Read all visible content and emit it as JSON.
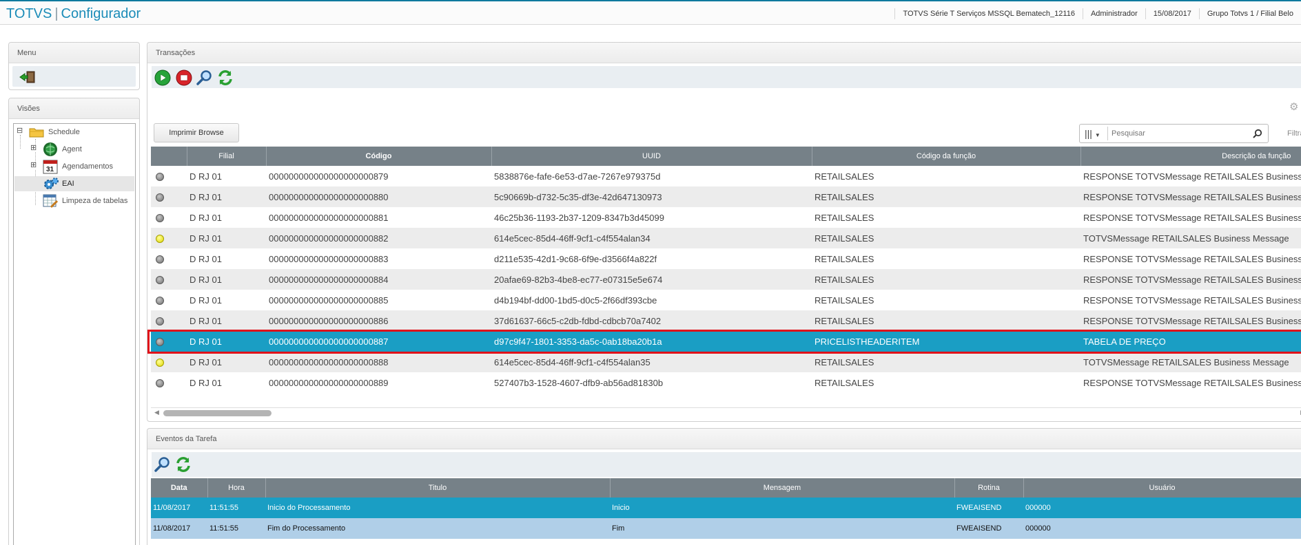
{
  "app": {
    "brand": "TOTVS",
    "separator": "|",
    "module": "Configurador"
  },
  "topinfo": {
    "environment": "TOTVS Série T Serviços MSSQL Bematech_12116",
    "user": "Administrador",
    "date": "15/08/2017",
    "company": "Grupo Totvs 1 / Filial Belo"
  },
  "menu": {
    "title": "Menu"
  },
  "visoes": {
    "title": "Visões",
    "root": {
      "toggle": "⊟",
      "label": "Schedule"
    },
    "items": [
      {
        "toggle": "⊞",
        "label": "Agent"
      },
      {
        "toggle": "⊞",
        "label": "Agendamentos"
      },
      {
        "toggle": "",
        "label": "EAI"
      },
      {
        "toggle": "",
        "label": "Limpeza de tabelas"
      }
    ]
  },
  "transacoes": {
    "title": "Transações",
    "print_button": "Imprimir Browse",
    "search_placeholder": "Pesquisar",
    "columns_icon": "|||",
    "filter_label": "Filtra",
    "columns": [
      "",
      "Filial",
      "Código",
      "UUID",
      "Código da função",
      "Descrição da função"
    ],
    "rows": [
      {
        "status": "gray",
        "filial": "D RJ 01",
        "codigo": "000000000000000000000879",
        "uuid": "5838876e-fafe-6e53-d7ae-7267e979375d",
        "funcao": "RETAILSALES",
        "descricao": "RESPONSE TOTVSMessage RETAILSALES Business"
      },
      {
        "status": "gray",
        "filial": "D RJ 01",
        "codigo": "000000000000000000000880",
        "uuid": "5c90669b-d732-5c35-df3e-42d647130973",
        "funcao": "RETAILSALES",
        "descricao": "RESPONSE TOTVSMessage RETAILSALES Business"
      },
      {
        "status": "gray",
        "filial": "D RJ 01",
        "codigo": "000000000000000000000881",
        "uuid": "46c25b36-1193-2b37-1209-8347b3d45099",
        "funcao": "RETAILSALES",
        "descricao": "RESPONSE TOTVSMessage RETAILSALES Business"
      },
      {
        "status": "yellow",
        "filial": "D RJ 01",
        "codigo": "000000000000000000000882",
        "uuid": "614e5cec-85d4-46ff-9cf1-c4f554alan34",
        "funcao": "RETAILSALES",
        "descricao": "TOTVSMessage RETAILSALES Business Message"
      },
      {
        "status": "gray",
        "filial": "D RJ 01",
        "codigo": "000000000000000000000883",
        "uuid": "d211e535-42d1-9c68-6f9e-d3566f4a822f",
        "funcao": "RETAILSALES",
        "descricao": "RESPONSE TOTVSMessage RETAILSALES Business"
      },
      {
        "status": "gray",
        "filial": "D RJ 01",
        "codigo": "000000000000000000000884",
        "uuid": "20afae69-82b3-4be8-ec77-e07315e5e674",
        "funcao": "RETAILSALES",
        "descricao": "RESPONSE TOTVSMessage RETAILSALES Business"
      },
      {
        "status": "gray",
        "filial": "D RJ 01",
        "codigo": "000000000000000000000885",
        "uuid": "d4b194bf-dd00-1bd5-d0c5-2f66df393cbe",
        "funcao": "RETAILSALES",
        "descricao": "RESPONSE TOTVSMessage RETAILSALES Business"
      },
      {
        "status": "gray",
        "filial": "D RJ 01",
        "codigo": "000000000000000000000886",
        "uuid": "37d61637-66c5-c2db-fdbd-cdbcb70a7402",
        "funcao": "RETAILSALES",
        "descricao": "RESPONSE TOTVSMessage RETAILSALES Business"
      },
      {
        "status": "gray",
        "filial": "D RJ 01",
        "codigo": "000000000000000000000887",
        "uuid": "d97c9f47-1801-3353-da5c-0ab18ba20b1a",
        "funcao": "PRICELISTHEADERITEM",
        "descricao": "TABELA DE PREÇO",
        "selected": true
      },
      {
        "status": "yellow",
        "filial": "D RJ 01",
        "codigo": "000000000000000000000888",
        "uuid": "614e5cec-85d4-46ff-9cf1-c4f554alan35",
        "funcao": "RETAILSALES",
        "descricao": "TOTVSMessage RETAILSALES Business Message"
      },
      {
        "status": "gray",
        "filial": "D RJ 01",
        "codigo": "000000000000000000000889",
        "uuid": "527407b3-1528-4607-dfb9-ab56ad81830b",
        "funcao": "RETAILSALES",
        "descricao": "RESPONSE TOTVSMessage RETAILSALES Business"
      }
    ]
  },
  "eventos": {
    "title": "Eventos da Tarefa",
    "columns": [
      "Data",
      "Hora",
      "Titulo",
      "Mensagem",
      "Rotina",
      "Usuário"
    ],
    "rows": [
      {
        "data": "11/08/2017",
        "hora": "11:51:55",
        "titulo": "Inicio do Processamento",
        "mensagem": "Inicio",
        "rotina": "FWEAISEND",
        "usuario": "000000"
      },
      {
        "data": "11/08/2017",
        "hora": "11:51:55",
        "titulo": "Fim do Processamento",
        "mensagem": "Fim",
        "rotina": "FWEAISEND",
        "usuario": "000000"
      }
    ]
  },
  "colors": {
    "accent": "#1b8cb8",
    "selected_row": "#1a9ec4",
    "header": "#768188",
    "highlight_border": "#e0121a"
  }
}
